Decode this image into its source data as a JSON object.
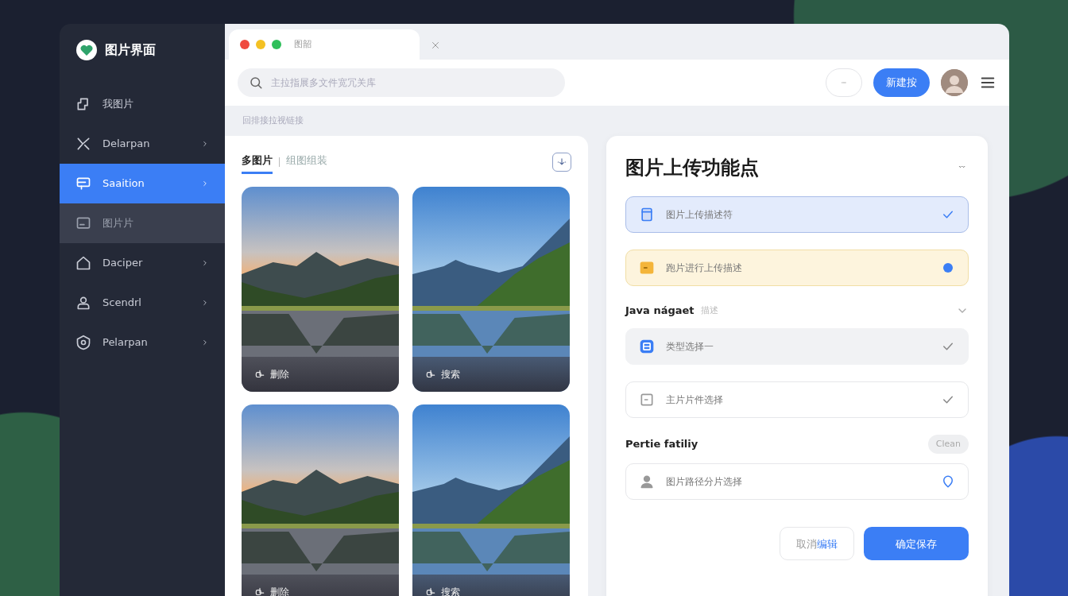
{
  "sidebar": {
    "logo": "图片界面",
    "items": [
      {
        "label": "我图片",
        "kind": "link",
        "selected": false
      },
      {
        "label": "Delarpan",
        "kind": "menu",
        "selected": false
      },
      {
        "label": "Saaition",
        "kind": "menu",
        "selected": true
      },
      {
        "label": "图片片",
        "kind": "sub",
        "selected": false
      },
      {
        "label": "Daciper",
        "kind": "menu",
        "selected": false
      },
      {
        "label": "Scendrl",
        "kind": "menu",
        "selected": false
      },
      {
        "label": "Pelarpan",
        "kind": "menu",
        "selected": false
      }
    ]
  },
  "browser_tab": {
    "title": "图韶"
  },
  "search": {
    "placeholder": "主拉指展多文件宽冗关库"
  },
  "toolbar": {
    "primary_button": "新建按"
  },
  "breadcrumb": "回排接拉视链接",
  "gallery": {
    "tabs": [
      {
        "label": "多图片",
        "selected": true
      },
      {
        "label": "组图组装",
        "selected": false
      }
    ],
    "photos": [
      {
        "caption": "删除",
        "kind": "sunset"
      },
      {
        "caption": "搜索",
        "kind": "day"
      },
      {
        "caption": "删除",
        "kind": "sunset"
      },
      {
        "caption": "搜索",
        "kind": "day"
      }
    ]
  },
  "panel": {
    "title": "图片上传功能点",
    "items": [
      {
        "kind": "active",
        "text": "图片上传描述符"
      },
      {
        "kind": "pending",
        "text": "跑片进行上传描述"
      },
      {
        "kind": "section",
        "text": "Java nágaet",
        "note": "描述"
      },
      {
        "kind": "filled",
        "text": "类型选择一"
      },
      {
        "kind": "plain",
        "text": "主片片件选择"
      },
      {
        "kind": "section",
        "text": "Pertie fatiliy",
        "action": "Clean"
      },
      {
        "kind": "location",
        "text": "图片路径分片选择"
      }
    ],
    "buttons": [
      {
        "kind": "secondary",
        "label": "取消",
        "accent": "编辑"
      },
      {
        "kind": "primary",
        "label": "确定保存"
      }
    ]
  }
}
